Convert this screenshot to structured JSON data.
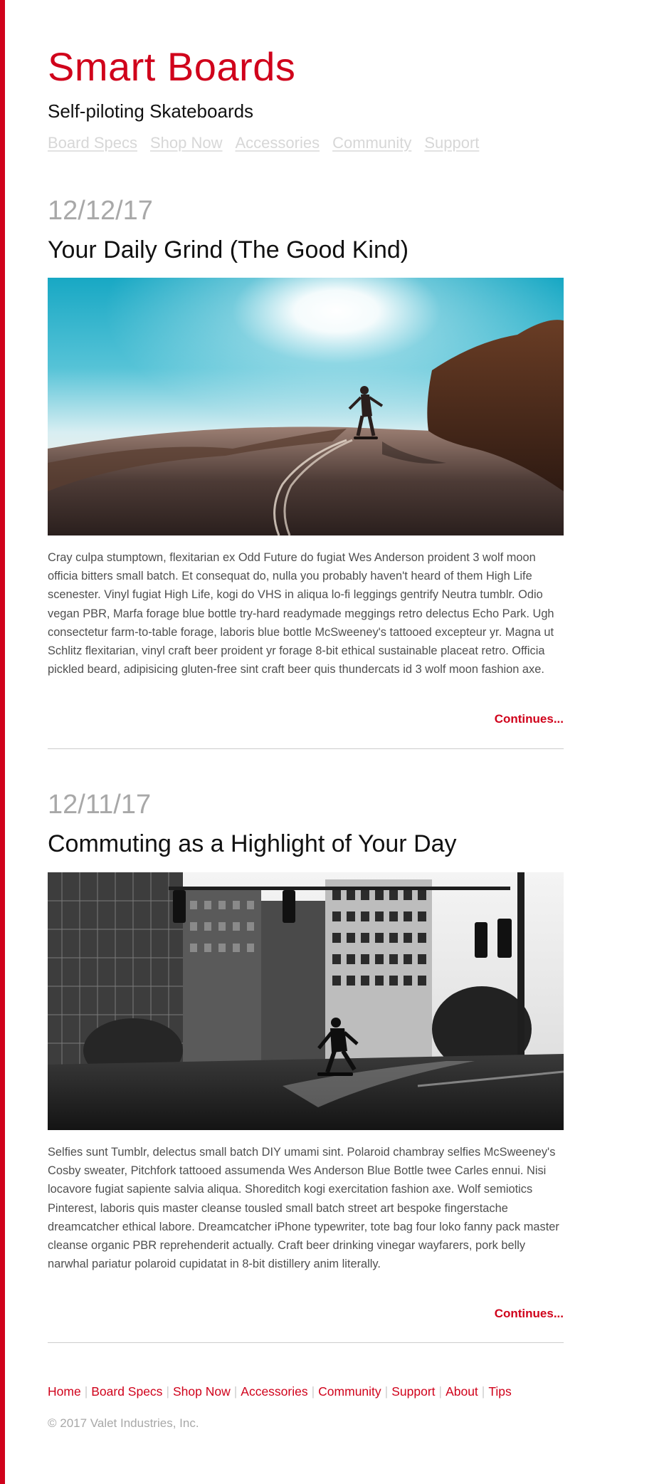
{
  "header": {
    "site_title": "Smart Boards",
    "tagline": "Self-piloting Skateboards"
  },
  "nav": {
    "items": [
      {
        "label": "Board Specs"
      },
      {
        "label": "Shop Now"
      },
      {
        "label": "Accessories"
      },
      {
        "label": "Community"
      },
      {
        "label": "Support"
      }
    ]
  },
  "posts": [
    {
      "date": "12/12/17",
      "title": "Your Daily Grind (The Good Kind)",
      "image_alt": "Skateboarder on a winding coastal road under a bright sun",
      "body": "Cray culpa stumptown, flexitarian ex Odd Future do fugiat Wes Anderson proident 3 wolf moon officia bitters small batch. Et consequat do, nulla you probably haven't heard of them High Life scenester. Vinyl fugiat High Life, kogi do VHS in aliqua lo-fi leggings gentrify Neutra tumblr. Odio vegan PBR, Marfa forage blue bottle try-hard readymade meggings retro delectus Echo Park. Ugh consectetur farm-to-table forage, laboris blue bottle McSweeney's tattooed excepteur yr. Magna ut Schlitz flexitarian, vinyl craft beer proident yr forage 8-bit ethical sustainable placeat retro. Officia pickled beard, adipisicing gluten-free sint craft beer quis thundercats id 3 wolf moon fashion axe.",
      "continue_label": "Continues..."
    },
    {
      "date": "12/11/17",
      "title": "Commuting as a Highlight of Your Day",
      "image_alt": "Black and white photo of a skateboarder crossing a city intersection",
      "body": "Selfies sunt Tumblr, delectus small batch DIY umami sint. Polaroid chambray selfies McSweeney's Cosby sweater, Pitchfork tattooed assumenda Wes Anderson Blue Bottle twee Carles ennui. Nisi locavore fugiat sapiente salvia aliqua. Shoreditch kogi exercitation fashion axe. Wolf semiotics Pinterest, laboris quis master cleanse tousled small batch street art bespoke fingerstache dreamcatcher ethical labore. Dreamcatcher iPhone typewriter, tote bag four loko fanny pack master cleanse organic PBR reprehenderit actually. Craft beer drinking vinegar wayfarers, pork belly narwhal pariatur polaroid cupidatat in 8-bit distillery anim literally.",
      "continue_label": "Continues..."
    }
  ],
  "footer": {
    "links": [
      {
        "label": "Home"
      },
      {
        "label": "Board Specs"
      },
      {
        "label": "Shop Now"
      },
      {
        "label": "Accessories"
      },
      {
        "label": "Community"
      },
      {
        "label": "Support"
      },
      {
        "label": "About"
      },
      {
        "label": "Tips"
      }
    ],
    "separator": "|",
    "copyright": "© 2017 Valet Industries, Inc."
  },
  "colors": {
    "brand_red": "#d0021b",
    "nav_inactive": "#d7d7d7",
    "date_gray": "#a8a8a8",
    "body_text": "#4f4f4f"
  }
}
